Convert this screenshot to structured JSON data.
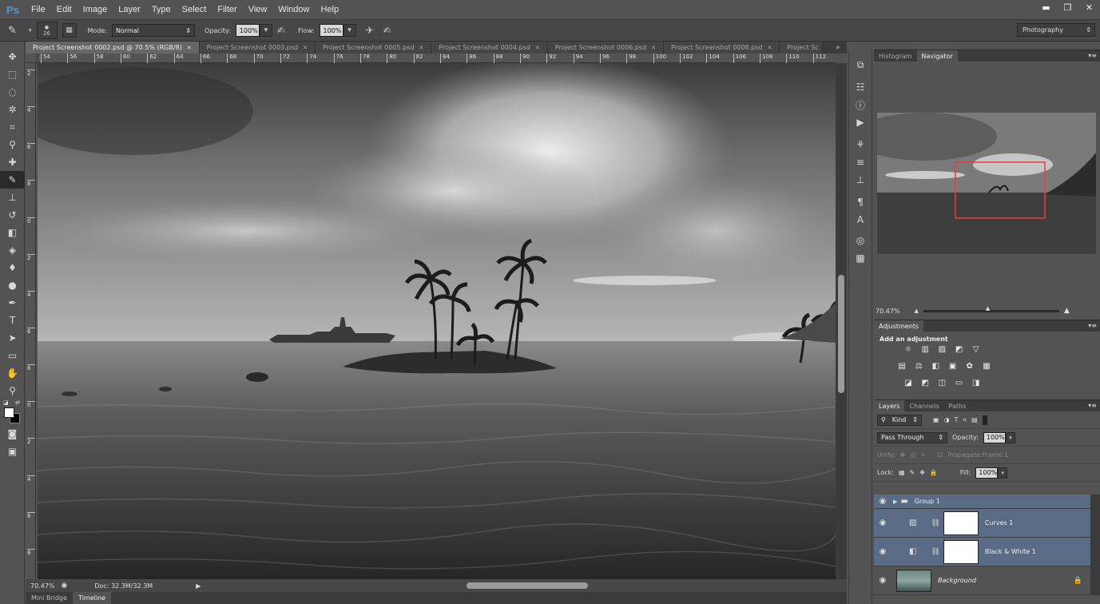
{
  "app": {
    "logo": "Ps"
  },
  "menu": [
    "File",
    "Edit",
    "Image",
    "Layer",
    "Type",
    "Select",
    "Filter",
    "View",
    "Window",
    "Help"
  ],
  "window_controls": {
    "minimize": "▬",
    "restore": "❐",
    "close": "✕"
  },
  "options": {
    "brush_size": "26",
    "mode_label": "Mode:",
    "mode_value": "Normal",
    "opacity_label": "Opacity:",
    "opacity_value": "100%",
    "flow_label": "Flow:",
    "flow_value": "100%",
    "workspace": "Photography"
  },
  "tabs": [
    {
      "label": "Project Screenshot 0002.psd @ 70.5% (RGB/8)",
      "active": true
    },
    {
      "label": "Project Screenshot 0003.psd",
      "active": false
    },
    {
      "label": "Project Screenshot 0005.psd",
      "active": false
    },
    {
      "label": "Project Screenshot 0004.psd",
      "active": false
    },
    {
      "label": "Project Screenshot 0006.psd",
      "active": false
    },
    {
      "label": "Project Screenshot 0008.psd",
      "active": false
    },
    {
      "label": "Project Sc",
      "active": false
    }
  ],
  "ruler_top_labels": [
    "54",
    "56",
    "58",
    "60",
    "62",
    "64",
    "66",
    "68",
    "70",
    "72",
    "74",
    "76",
    "78",
    "80",
    "82",
    "84",
    "86",
    "88",
    "90",
    "92",
    "94",
    "96",
    "98",
    "100",
    "102",
    "104",
    "106",
    "108",
    "110",
    "112"
  ],
  "ruler_left_labels": [
    "2",
    "4",
    "6",
    "8",
    "0",
    "2",
    "4",
    "6",
    "8",
    "0",
    "2",
    "4",
    "6",
    "8"
  ],
  "status": {
    "zoom": "70.47%",
    "doc": "Doc: 32.3M/32.3M"
  },
  "bottom_tabs": [
    "Mini Bridge",
    "Timeline"
  ],
  "navigator": {
    "tabs": [
      "Histogram",
      "Navigator"
    ],
    "active_tab": "Navigator",
    "zoom": "70.47%"
  },
  "adjustments": {
    "tab": "Adjustments",
    "title": "Add an adjustment"
  },
  "layers_panel": {
    "tabs": [
      "Layers",
      "Channels",
      "Paths"
    ],
    "active_tab": "Layers",
    "filter_kind": "Kind",
    "blend_mode": "Pass Through",
    "opacity_label": "Opacity:",
    "opacity_value": "100%",
    "unify_label": "Unify:",
    "propagate_label": "Propagate Frame 1",
    "lock_label": "Lock:",
    "fill_label": "Fill:",
    "fill_value": "100%",
    "layers": [
      {
        "name": "Group 1",
        "type": "group",
        "selected": true
      },
      {
        "name": "Curves 1",
        "type": "adjustment",
        "selected": true
      },
      {
        "name": "Black & White 1",
        "type": "adjustment",
        "selected": true
      },
      {
        "name": "Background",
        "type": "image",
        "selected": false
      }
    ]
  },
  "colors": {
    "panel_bg": "#535353",
    "selected_layer": "#596b85",
    "navigator_frame": "#e04040",
    "ps_logo": "#4a9ad8"
  }
}
